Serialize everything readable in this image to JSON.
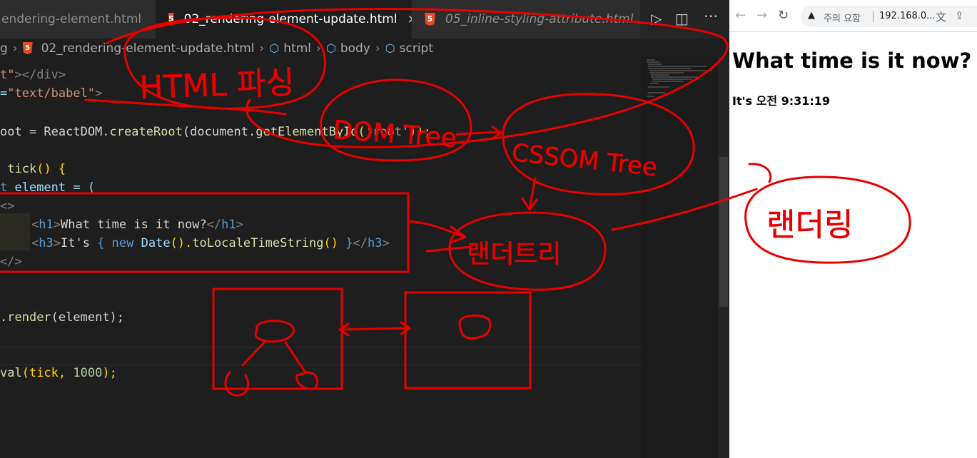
{
  "editor": {
    "tabs": [
      {
        "label": "endering-element.html",
        "active": false,
        "italic": false
      },
      {
        "label": "02_rendering-element-update.html",
        "active": true,
        "italic": false
      },
      {
        "label": "05_inline-styling-attribute.html",
        "active": false,
        "italic": true
      }
    ],
    "close_glyph": "×",
    "breadcrumb": {
      "lead": "g",
      "file": "02_rendering-element-update.html",
      "path": [
        "html",
        "body",
        "script"
      ]
    },
    "code": {
      "l1_a": "t\"",
      "l1_b": "></div>",
      "l2_a": "=",
      "l2_b": "\"text/babel\"",
      "l2_c": ">",
      "l4_a": "oot = ReactDOM.",
      "l4_b": "createRoot",
      "l4_c": "(document.",
      "l4_d": "getElementById",
      "l4_e": "(",
      "l4_f": "'root'",
      "l4_g": "));",
      "l6_a": " ",
      "l6_b": "tick",
      "l6_c": "() {",
      "l7_a": "t",
      "l7_b": " element = (",
      "l8": "<>",
      "l9_a": "<",
      "l9_b": "h1",
      "l9_c": ">",
      "l9_d": "What time is it now?",
      "l9_e": "</",
      "l9_f": "h1",
      "l9_g": ">",
      "l10_a": "<",
      "l10_b": "h3",
      "l10_c": ">",
      "l10_d": "It's ",
      "l10_e": "{ ",
      "l10_f": "new",
      "l10_g": " Date",
      "l10_h": "().",
      "l10_i": "toLocaleTimeString",
      "l10_j": "() ",
      "l10_k": "}",
      "l10_l": "</",
      "l10_m": "h3",
      "l10_n": ">",
      "l11": "</>",
      "l13_a": ".",
      "l13_b": "render",
      "l13_c": "(element);",
      "l16_a": "val",
      "l16_b": "(tick, ",
      "l16_c": "1000",
      "l16_d": ");"
    }
  },
  "browser": {
    "back": "←",
    "forward": "→",
    "reload": "↻",
    "warning_icon": "▲",
    "warning_text": "주의 요함",
    "url": "192.168.0...",
    "page": {
      "h1": "What time is it now?",
      "h3": "It's 오전 9:31:19"
    }
  },
  "annotations": {
    "html_parsing": "HTML 파싱",
    "dom_tree": "DOM Tree",
    "cssom_tree": "CSSOM Tree",
    "rendering_1": "랜더트리",
    "rendering_2": "랜더링"
  },
  "colors": {
    "ink": "#e60000",
    "editor_bg": "#1e1e1e",
    "tab_active_bg": "#1e1e1e",
    "tab_bg": "#2d2d2d",
    "html5_icon": "#e44d26"
  },
  "icons": [
    "html5-file-icon",
    "close-icon",
    "run-icon",
    "split-editor-icon",
    "symbol-element-icon",
    "back-arrow-icon",
    "forward-arrow-icon",
    "reload-icon",
    "warning-icon",
    "translate-icon",
    "share-icon"
  ]
}
